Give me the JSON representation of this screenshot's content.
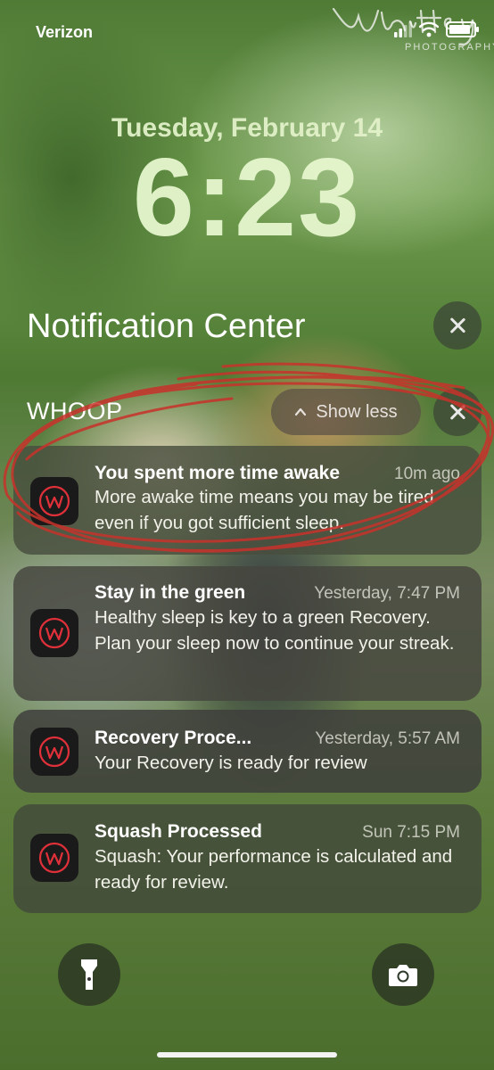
{
  "status_bar": {
    "carrier": "Verizon",
    "icons": [
      "signal-icon",
      "wifi-icon",
      "battery-icon"
    ],
    "battery_level": 0.9
  },
  "watermark": {
    "line1": "Whitney",
    "line2": "PHOTOGRAPHY"
  },
  "lock_screen": {
    "date": "Tuesday, February 14",
    "time": "6:23"
  },
  "notification_center": {
    "title": "Notification Center",
    "close_icon": "close-icon"
  },
  "group": {
    "app_name": "WHOOP",
    "show_less_label": "Show less",
    "notifications": [
      {
        "title": "You spent more time awake",
        "time": "10m ago",
        "body": "More awake time means you may be tired even if you got sufficient sleep."
      },
      {
        "title": "Stay in the green",
        "time": "Yesterday, 7:47 PM",
        "body": "Healthy sleep is key to a green Recovery. Plan your sleep now to continue your streak."
      },
      {
        "title": "Recovery Proce...",
        "time": "Yesterday, 5:57 AM",
        "body": "Your Recovery is ready for review"
      },
      {
        "title": "Squash Processed",
        "time": "Sun 7:15 PM",
        "body": "Squash: Your performance is calculated and ready for review."
      }
    ]
  },
  "colors": {
    "whoop_icon_bg": "#1a1a1a",
    "whoop_icon_accent": "#e0303a",
    "scribble": "#c8322b"
  },
  "controls": {
    "left": "flashlight-icon",
    "right": "camera-icon"
  }
}
